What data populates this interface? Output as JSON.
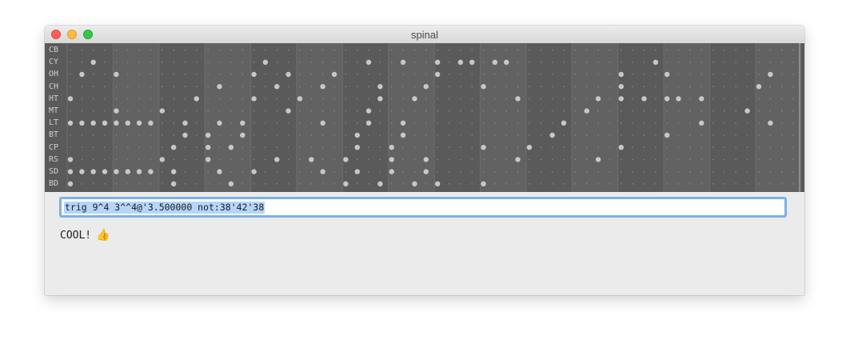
{
  "window": {
    "title": "spinal"
  },
  "sequencer": {
    "rows": [
      {
        "label": "CB",
        "steps": []
      },
      {
        "label": "CY",
        "steps": [
          2,
          17,
          26,
          29,
          32,
          34,
          35,
          37,
          38,
          51
        ]
      },
      {
        "label": "OH",
        "steps": [
          1,
          4,
          16,
          19,
          23,
          32,
          48,
          52,
          61
        ]
      },
      {
        "label": "CH",
        "steps": [
          13,
          18,
          22,
          27,
          31,
          36,
          48,
          60
        ]
      },
      {
        "label": "HT",
        "steps": [
          0,
          11,
          16,
          20,
          27,
          30,
          39,
          46,
          48,
          50,
          52,
          53,
          55
        ]
      },
      {
        "label": "MT",
        "steps": [
          4,
          8,
          19,
          26,
          45,
          59
        ]
      },
      {
        "label": "LT",
        "steps": [
          0,
          1,
          2,
          3,
          4,
          5,
          6,
          7,
          10,
          13,
          15,
          22,
          26,
          29,
          43,
          55,
          61
        ]
      },
      {
        "label": "BT",
        "steps": [
          10,
          12,
          15,
          25,
          29,
          42,
          52
        ]
      },
      {
        "label": "CP",
        "steps": [
          9,
          12,
          14,
          25,
          28,
          36,
          40,
          48
        ]
      },
      {
        "label": "RS",
        "steps": [
          0,
          8,
          12,
          18,
          21,
          24,
          28,
          31,
          39,
          46
        ]
      },
      {
        "label": "SD",
        "steps": [
          0,
          1,
          2,
          3,
          4,
          5,
          6,
          7,
          9,
          13,
          16,
          22,
          25,
          28,
          31
        ]
      },
      {
        "label": "BD",
        "steps": [
          0,
          9,
          14,
          24,
          27,
          30,
          32,
          36
        ]
      }
    ]
  },
  "command": {
    "value": "trig 9^4 3^^4@'3.500000 not:38'42'38"
  },
  "status": {
    "message": "COOL!",
    "emoji": "👍"
  },
  "colors": {
    "grid_bg": "#5a5a5a",
    "beat_alt": "#626262",
    "dot": "#c8c8c8",
    "input_focus": "#7ab2e8",
    "selection": "#b5d5fb"
  }
}
